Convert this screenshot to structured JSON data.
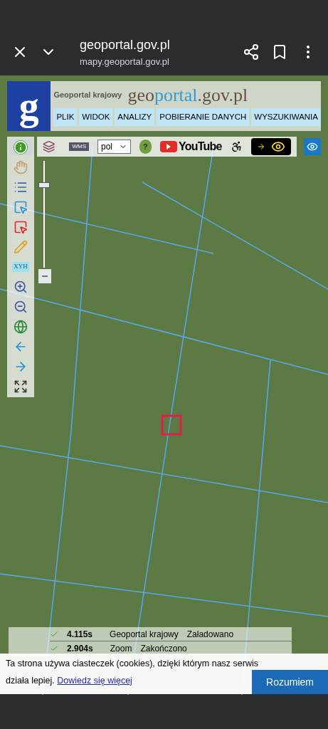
{
  "browser_bar": {
    "title": "geoportal.gov.pl",
    "url": "mapy.geoportal.gov.pl"
  },
  "header": {
    "subtitle": "Geoportal krajowy",
    "logo_parts": [
      "geo",
      "portal",
      ".gov.pl"
    ],
    "logo_letter": "g"
  },
  "menu": [
    {
      "label": "PLIK"
    },
    {
      "label": "WIDOK"
    },
    {
      "label": "ANALIZY"
    },
    {
      "label": "POBIERANIE DANYCH"
    },
    {
      "label": "WYSZUKIWANIA"
    }
  ],
  "top_toolbar": {
    "wms_label": "WMS",
    "language": "pol",
    "help": "?",
    "youtube": "YouTube"
  },
  "side_tools": [
    {
      "kind": "info",
      "selected": true
    },
    {
      "kind": "pan",
      "selected": false
    },
    {
      "kind": "legend",
      "selected": false
    },
    {
      "kind": "select-blue",
      "selected": false
    },
    {
      "kind": "select-red",
      "selected": false
    },
    {
      "kind": "pencil",
      "selected": false
    },
    {
      "kind": "xyh",
      "label": "XYH",
      "selected": false
    },
    {
      "kind": "zoom-in",
      "selected": false
    },
    {
      "kind": "zoom-out",
      "selected": false
    },
    {
      "kind": "globe",
      "selected": false
    },
    {
      "kind": "back",
      "selected": false
    },
    {
      "kind": "forward",
      "selected": false
    },
    {
      "kind": "extent",
      "selected": false
    }
  ],
  "zoom_slider": {
    "level": 0.8
  },
  "status_log": [
    {
      "time": "4.115s",
      "source": "Geoportal krajowy",
      "status": "Załadowano"
    },
    {
      "time": "2.904s",
      "source": "Zoom",
      "status": "Zakończono"
    }
  ],
  "cookie_banner": {
    "text": "Ta strona używa ciasteczek (cookies), dzięki którym nasz serwis działa lepiej.",
    "link": "Dowiedz się więcej",
    "button": "Rozumiem"
  }
}
